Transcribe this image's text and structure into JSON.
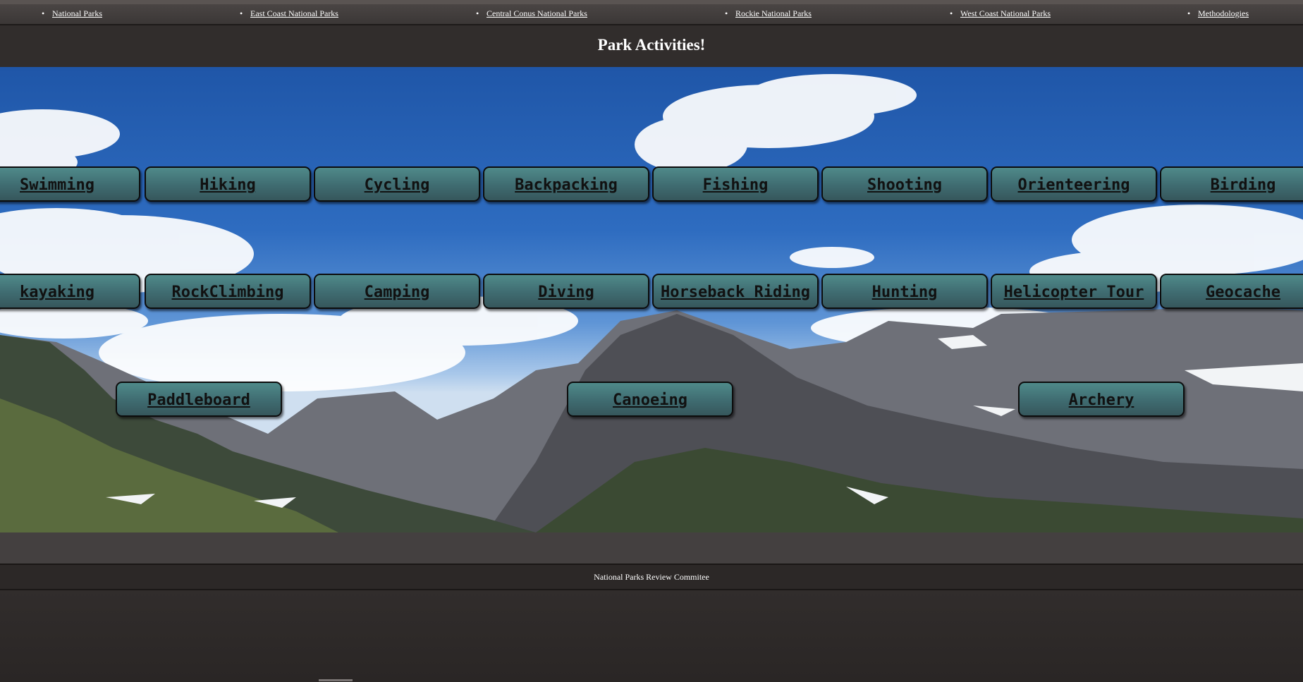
{
  "nav": {
    "items": [
      {
        "label": "National Parks"
      },
      {
        "label": "East Coast National Parks"
      },
      {
        "label": "Central Conus National Parks"
      },
      {
        "label": "Rockie National Parks"
      },
      {
        "label": "West Coast National Parks"
      },
      {
        "label": "Methodologies"
      }
    ]
  },
  "header": {
    "title": "Park Activities!"
  },
  "activities": {
    "row1": [
      "Swimming",
      "Hiking",
      "Cycling",
      "Backpacking",
      "Fishing",
      "Shooting",
      "Orienteering",
      "Birding"
    ],
    "row2": [
      "kayaking",
      "RockClimbing",
      "Camping",
      "Diving",
      "Horseback Riding",
      "Hunting",
      "Helicopter Tour",
      "Geocache"
    ],
    "row3": [
      "Paddleboard",
      "Canoeing",
      "Archery"
    ]
  },
  "footer": {
    "text": "National Parks Review Commitee"
  },
  "colors": {
    "button_fill": "#4a7a7c",
    "page_bg": "#2e2a29",
    "sky": "#2e6cc0"
  }
}
